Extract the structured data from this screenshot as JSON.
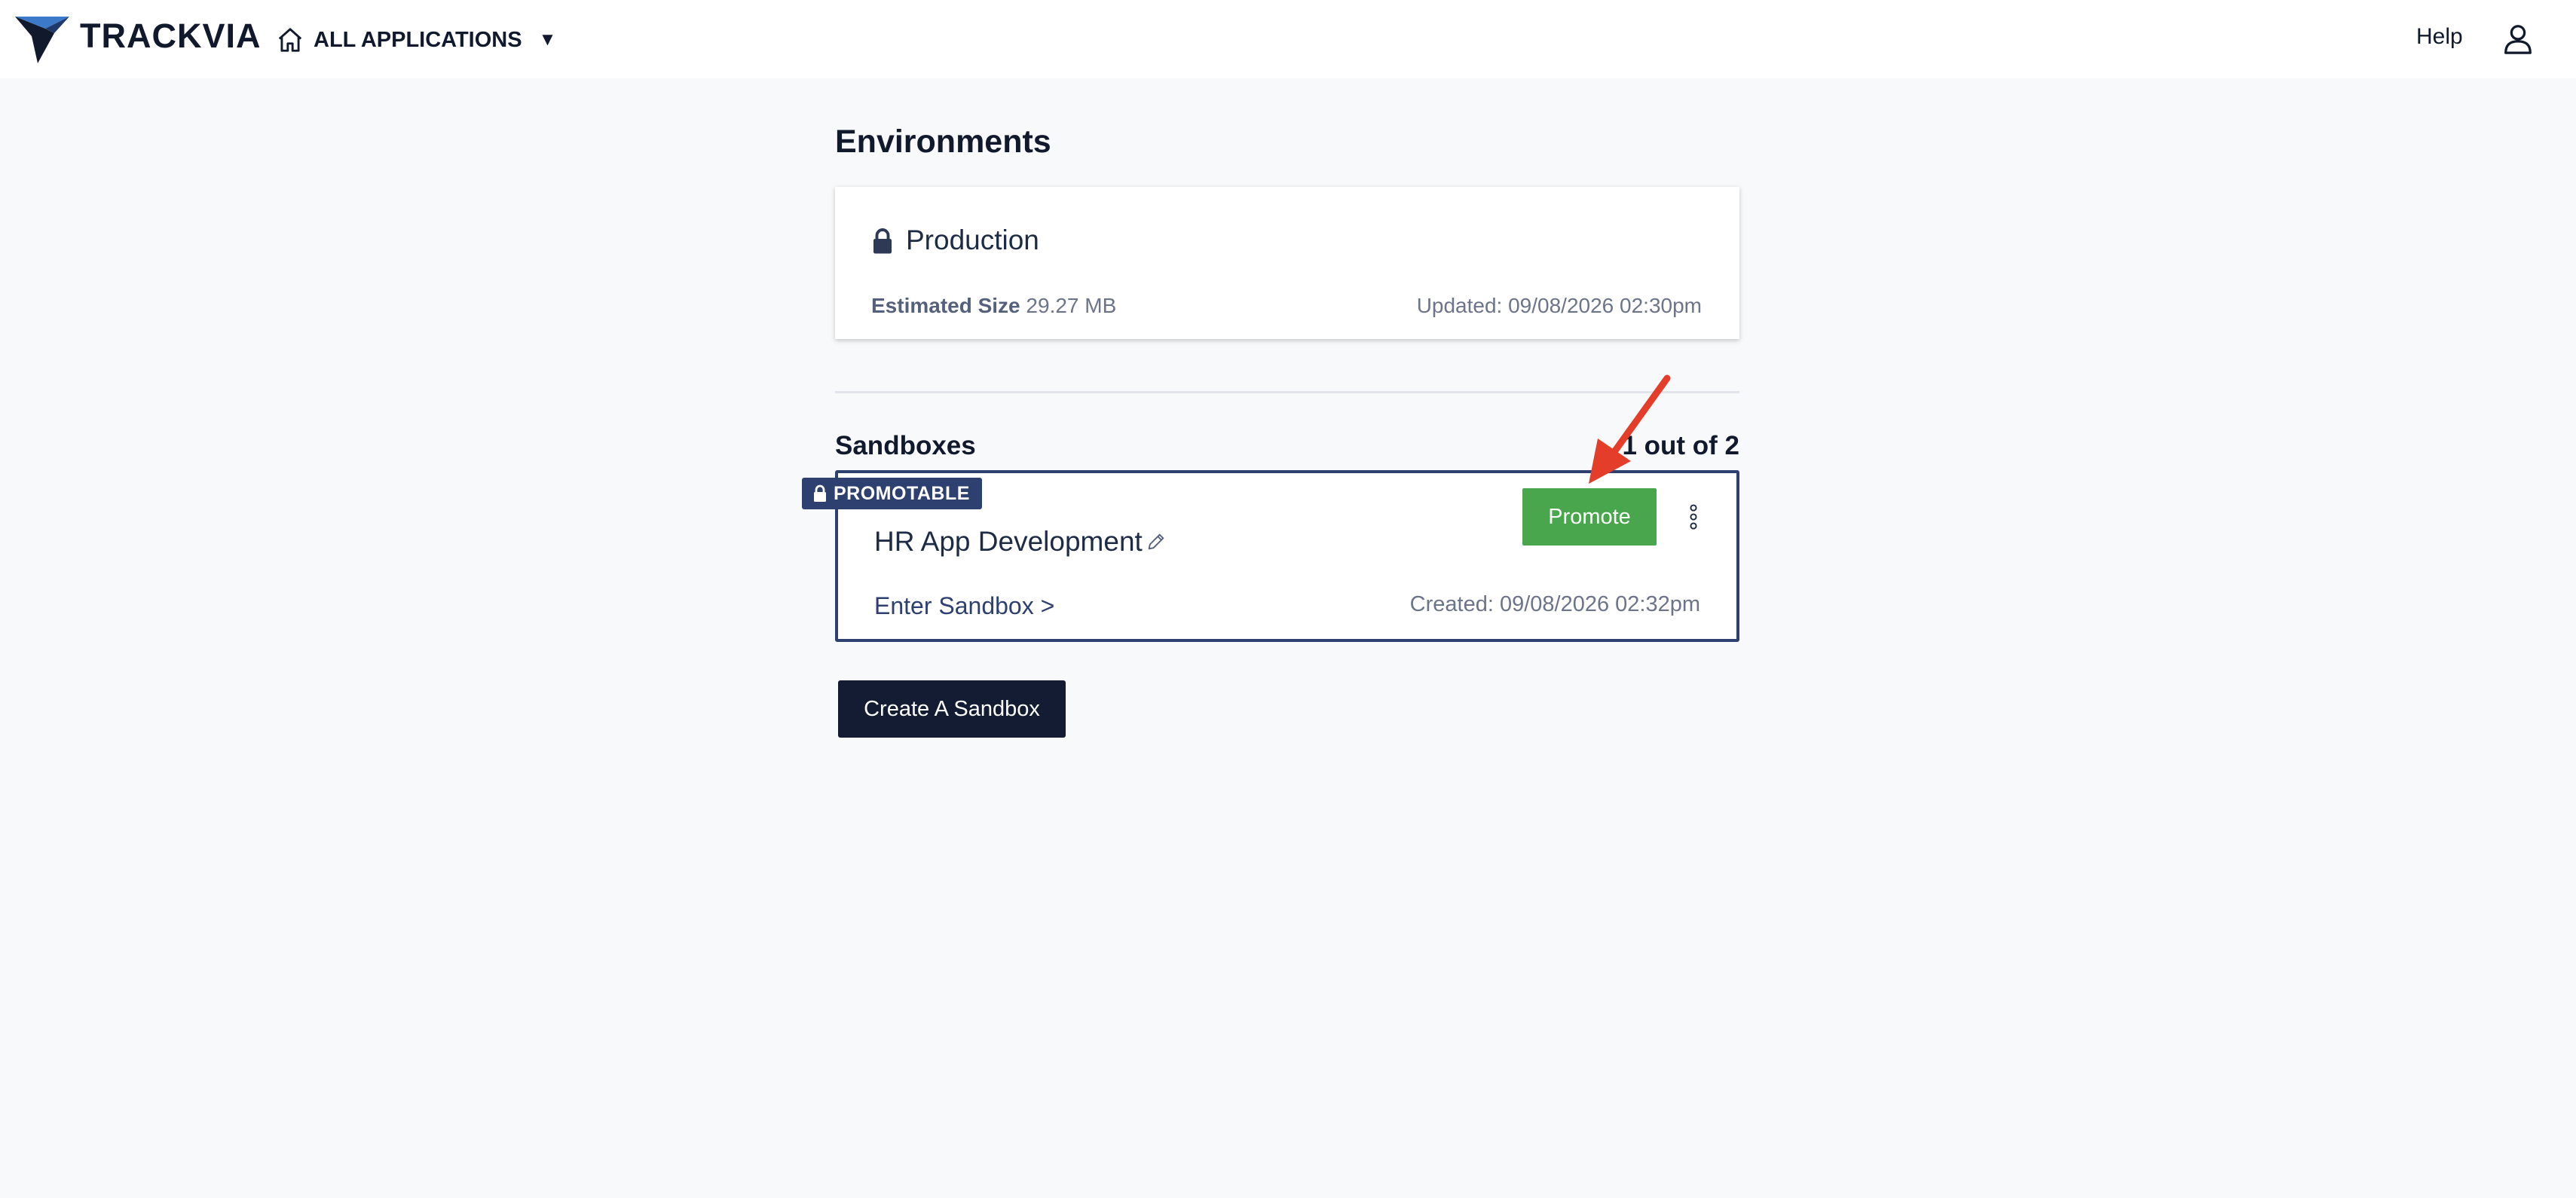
{
  "header": {
    "brand": "TRACKVIA",
    "apps_menu_label": "ALL APPLICATIONS",
    "help_label": "Help"
  },
  "environments": {
    "heading": "Environments",
    "production": {
      "title": "Production",
      "size_label": "Estimated Size",
      "size_value": "29.27 MB",
      "updated": "Updated: 09/08/2026 02:30pm"
    }
  },
  "sandboxes": {
    "heading": "Sandboxes",
    "count": "1 out of 2",
    "items": [
      {
        "badge": "PROMOTABLE",
        "name": "HR App Development",
        "enter_label": "Enter Sandbox >",
        "created": "Created: 09/08/2026 02:32pm",
        "promote_label": "Promote"
      }
    ],
    "create_label": "Create A Sandbox"
  },
  "colors": {
    "promote": "#4aa64c",
    "navy": "#2e4070",
    "annotation_arrow": "#e43d2a"
  }
}
